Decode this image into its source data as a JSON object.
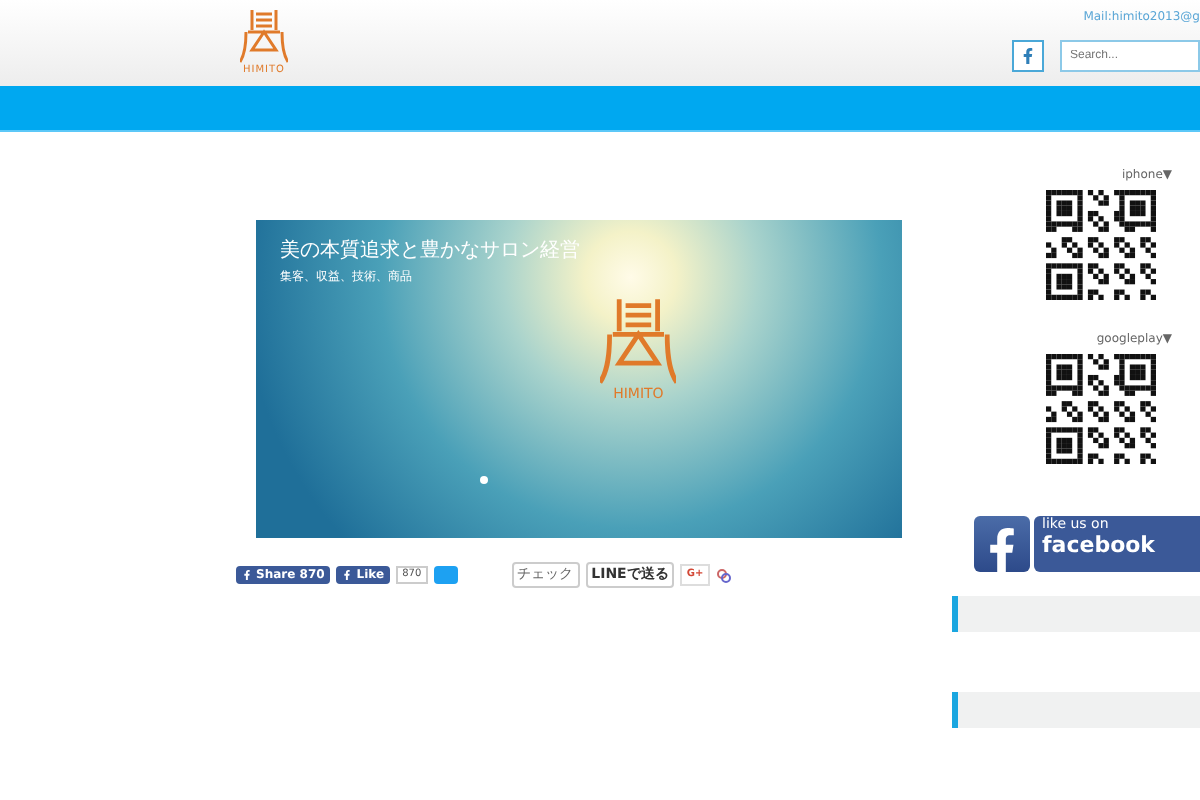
{
  "header": {
    "logo_text": "HIMITO",
    "mail": "Mail:himito2013@g",
    "search": {
      "placeholder": "Search..."
    }
  },
  "slider": {
    "title": "美の本質追求と豊かなサロン経営",
    "subtitle": "集客、収益、技術、商品",
    "logo_text": "HIMITO",
    "dots": [
      {
        "selected": true
      }
    ]
  },
  "share": {
    "fb_share": "Share",
    "fb_share_count": "870",
    "fb_like": "Like",
    "fb_like_count": "870",
    "check": "チェック",
    "line": "LINEで送る",
    "gplus": "G+"
  },
  "sidebar": {
    "qr": [
      {
        "label": "iphone▼"
      },
      {
        "label": "googleplay▼"
      }
    ],
    "facebook_banner": {
      "line1": "like us on",
      "line2": "facebook"
    },
    "widgets": [
      {
        "kind": "panel"
      },
      {
        "kind": "panel"
      }
    ]
  }
}
